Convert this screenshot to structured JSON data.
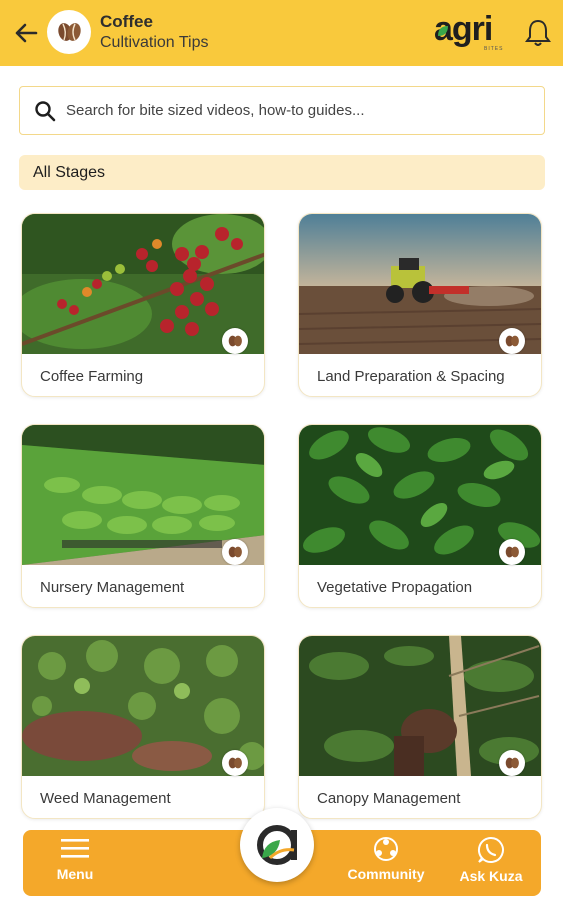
{
  "header": {
    "title": "Coffee",
    "subtitle": "Cultivation Tips",
    "back_icon": "arrow-left-icon",
    "crop_icon": "coffee-bean-icon",
    "logo_text": "agri",
    "logo_subtext": "BITES",
    "notification_icon": "bell-icon"
  },
  "search": {
    "placeholder": "Search for bite sized videos, how-to guides...",
    "value": ""
  },
  "filter": {
    "stage_label": "All Stages"
  },
  "cards": [
    {
      "label": "Coffee Farming",
      "image": "coffee-cherries-photo"
    },
    {
      "label": "Land Preparation & Spacing",
      "image": "tractor-field-photo"
    },
    {
      "label": "Nursery Management",
      "image": "nursery-seedlings-photo"
    },
    {
      "label": "Vegetative Propagation",
      "image": "coffee-leaves-photo"
    },
    {
      "label": "Weed Management",
      "image": "weedy-ground-photo"
    },
    {
      "label": "Canopy Management",
      "image": "hand-on-trunk-photo"
    }
  ],
  "bottom_nav": {
    "menu_label": "Menu",
    "community_label": "Community",
    "ask_label": "Ask Kuza"
  },
  "colors": {
    "header_bg": "#f9c93c",
    "nav_bg": "#f4a82a",
    "stage_bg": "#fdedc7",
    "bean": "#7a4a2e"
  }
}
